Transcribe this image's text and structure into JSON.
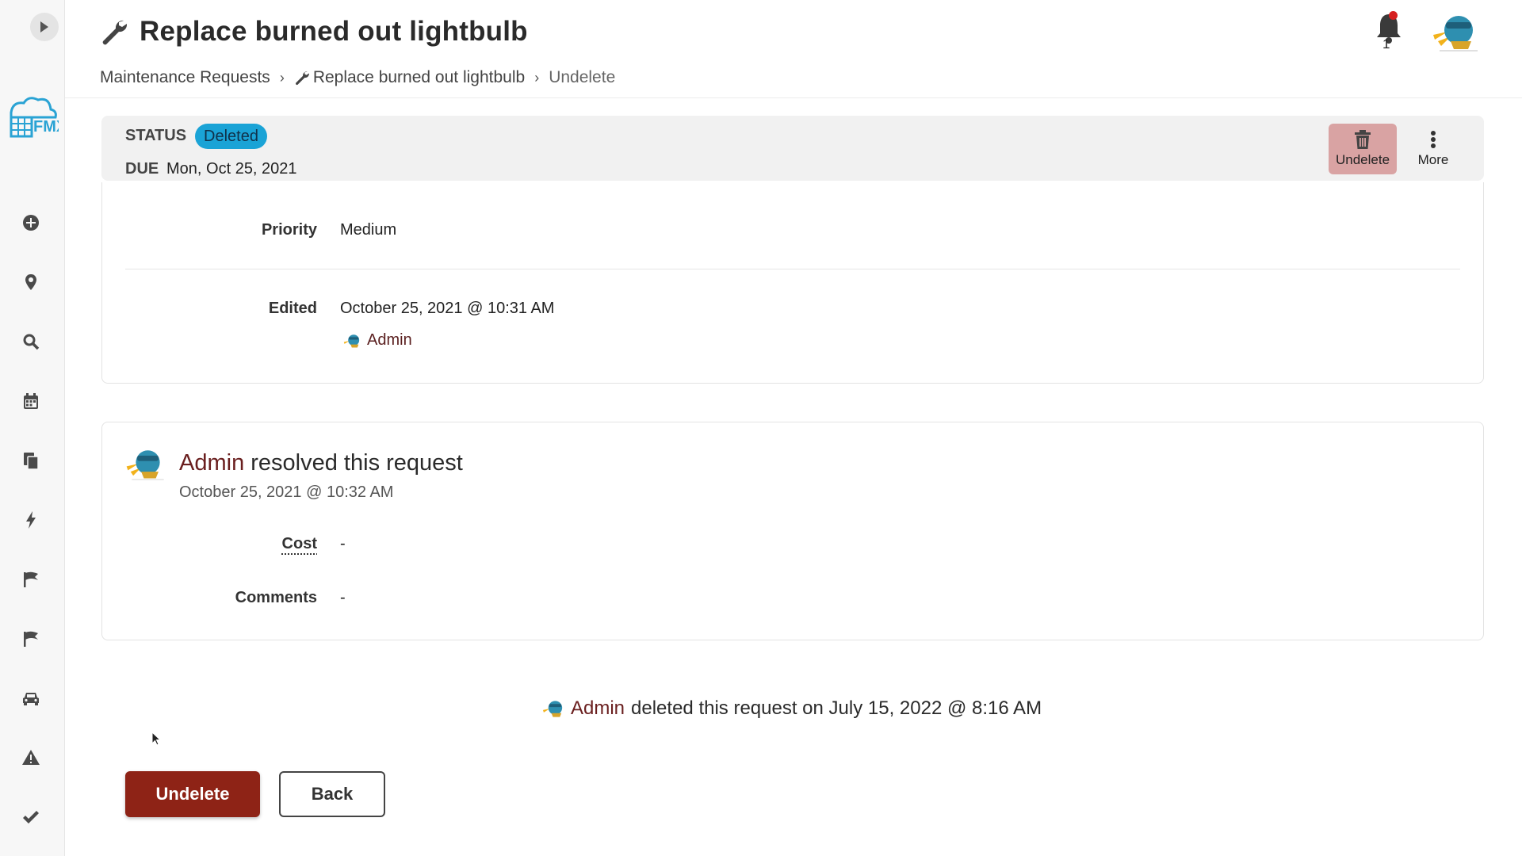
{
  "header": {
    "title": "Replace burned out lightbulb",
    "notifications_count": "1"
  },
  "breadcrumb": {
    "items": [
      "Maintenance Requests",
      "Replace burned out lightbulb",
      "Undelete"
    ]
  },
  "status_bar": {
    "status_label": "STATUS",
    "status_value": "Deleted",
    "due_label": "DUE",
    "due_value": "Mon, Oct 25, 2021",
    "undelete_label": "Undelete",
    "more_label": "More"
  },
  "details": {
    "priority_label": "Priority",
    "priority_value": "Medium",
    "edited_label": "Edited",
    "edited_value": "October 25, 2021 @ 10:31 AM",
    "edited_by": "Admin"
  },
  "resolution": {
    "user": "Admin",
    "action_text": "resolved this request",
    "date": "October 25, 2021 @ 10:32 AM",
    "cost_label": "Cost",
    "cost_value": "-",
    "comments_label": "Comments",
    "comments_value": "-"
  },
  "deletion": {
    "user": "Admin",
    "text": "deleted this request on July 15, 2022 @ 8:16 AM"
  },
  "actions": {
    "undelete_label": "Undelete",
    "back_label": "Back"
  },
  "sidebar": {
    "icons": [
      "plus-circle-icon",
      "map-pin-icon",
      "search-icon",
      "calendar-icon",
      "documents-icon",
      "lightning-icon",
      "flag-icon",
      "flag-icon",
      "car-icon",
      "warning-icon",
      "check-icon"
    ]
  },
  "colors": {
    "status_badge": "#1aa3d6",
    "primary_button": "#8e2316",
    "user_link": "#6a1f1f",
    "undelete_top_button": "#d9a3a3"
  }
}
